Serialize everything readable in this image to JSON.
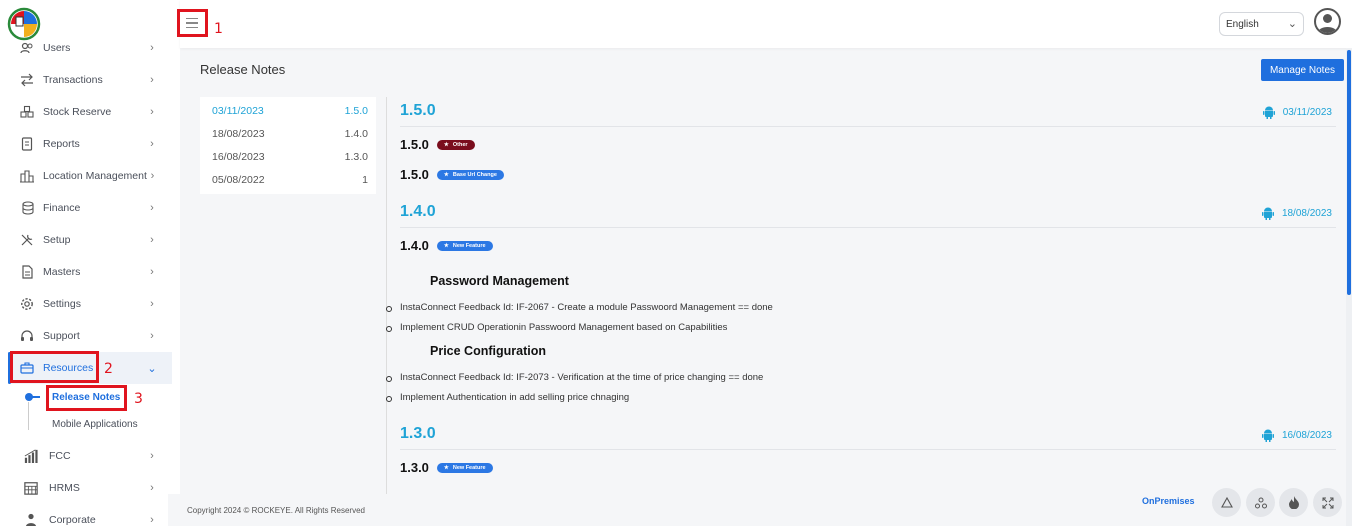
{
  "header": {
    "language": "English",
    "annotation_1": "1"
  },
  "sidebar": {
    "items": [
      {
        "label": "Users",
        "icon": "users-icon"
      },
      {
        "label": "Transactions",
        "icon": "transfer-icon"
      },
      {
        "label": "Stock Reserve",
        "icon": "stock-icon"
      },
      {
        "label": "Reports",
        "icon": "report-icon"
      },
      {
        "label": "Location Management",
        "icon": "location-icon"
      },
      {
        "label": "Finance",
        "icon": "finance-icon"
      },
      {
        "label": "Setup",
        "icon": "setup-icon"
      },
      {
        "label": "Masters",
        "icon": "masters-icon"
      },
      {
        "label": "Settings",
        "icon": "settings-icon"
      },
      {
        "label": "Support",
        "icon": "support-icon"
      },
      {
        "label": "Resources",
        "icon": "briefcase-icon"
      },
      {
        "label": "FCC",
        "icon": "chart-icon"
      },
      {
        "label": "HRMS",
        "icon": "calendar-icon"
      },
      {
        "label": "Corporate",
        "icon": "person-icon"
      }
    ],
    "sub_items": [
      "Release Notes",
      "Mobile Applications"
    ],
    "annotation_2": "2",
    "annotation_3": "3"
  },
  "main": {
    "title": "Release Notes",
    "manage_button": "Manage Notes",
    "versions": [
      {
        "date": "03/11/2023",
        "version": "1.5.0"
      },
      {
        "date": "18/08/2023",
        "version": "1.4.0"
      },
      {
        "date": "16/08/2023",
        "version": "1.3.0"
      },
      {
        "date": "05/08/2022",
        "version": "1"
      }
    ],
    "notes": {
      "v150": {
        "title": "1.5.0",
        "date": "03/11/2023",
        "sub1": "1.5.0",
        "badge1": "Other",
        "sub2": "1.5.0",
        "badge2": "Base Url Change"
      },
      "v140": {
        "title": "1.4.0",
        "date": "18/08/2023",
        "sub1": "1.4.0",
        "badge1": "New Feature",
        "section1": "Password Management",
        "bullets1": [
          "InstaConnect Feedback Id: IF-2067 - Create a module Passwoord Management == done",
          "Implement CRUD Operationin Passwoord Management based on Capabilities"
        ],
        "section2": "Price Configuration",
        "bullets2": [
          "InstaConnect Feedback Id: IF-2073 - Verification at the time of price changing == done",
          "Implement Authentication in add selling price chnaging"
        ]
      },
      "v130": {
        "title": "1.3.0",
        "date": "16/08/2023",
        "sub1": "1.3.0",
        "badge1": "New Feature"
      }
    }
  },
  "footer": {
    "copyright": "Copyright 2024 © ROCKEYE. All Rights Reserved",
    "mode": "OnPremises"
  },
  "colors": {
    "accent": "#1f6fde",
    "version": "#1fa3d6",
    "annotation": "#e0141e",
    "badge_other": "#7a0d1d"
  }
}
